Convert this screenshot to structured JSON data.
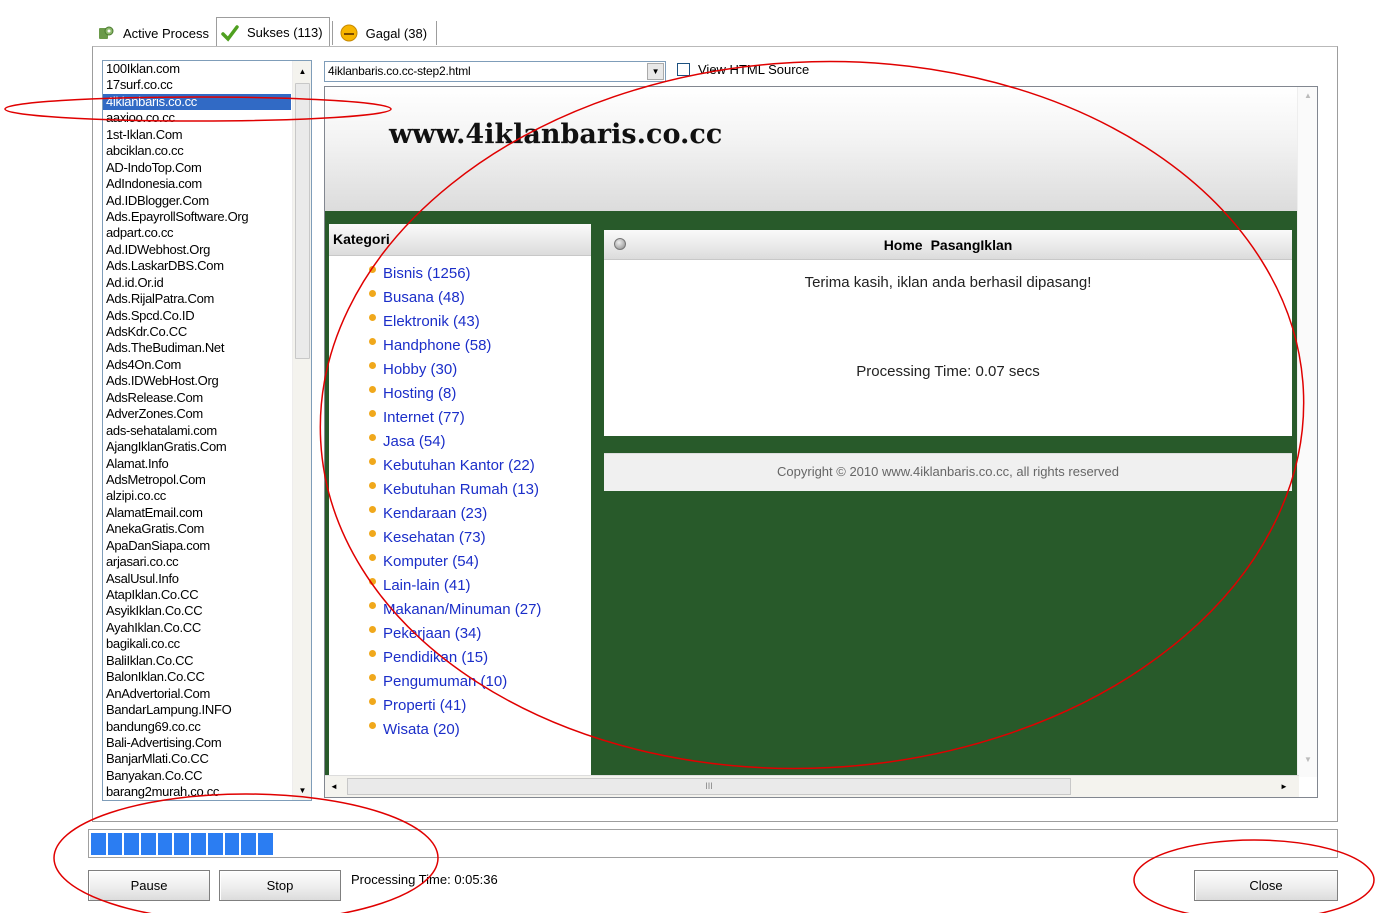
{
  "tabs": [
    {
      "label": "Active Process",
      "icon": "gear-process-icon",
      "active": false
    },
    {
      "label": "Sukses (113)",
      "icon": "checkmark-icon",
      "active": true
    },
    {
      "label": "Gagal (38)",
      "icon": "sad-face-icon",
      "active": false
    }
  ],
  "site_list": {
    "selected": "4iklanbaris.co.cc",
    "items": [
      "100Iklan.com",
      "17surf.co.cc",
      "4iklanbaris.co.cc",
      "aaxioo.co.cc",
      "1st-Iklan.Com",
      "abciklan.co.cc",
      "AD-IndoTop.Com",
      "AdIndonesia.com",
      "Ad.IDBlogger.Com",
      "Ads.EpayrollSoftware.Org",
      "adpart.co.cc",
      "Ad.IDWebhost.Org",
      "Ads.LaskarDBS.Com",
      "Ad.id.Or.id",
      "Ads.RijalPatra.Com",
      "Ads.Spcd.Co.ID",
      "AdsKdr.Co.CC",
      "Ads.TheBudiman.Net",
      "Ads4On.Com",
      "Ads.IDWebHost.Org",
      "AdsRelease.Com",
      "AdverZones.Com",
      "ads-sehatalami.com",
      "AjangIklanGratis.Com",
      "Alamat.Info",
      "AdsMetropol.Com",
      "alzipi.co.cc",
      "AlamatEmail.com",
      "AnekaGratis.Com",
      "ApaDanSiapa.com",
      "arjasari.co.cc",
      "AsalUsul.Info",
      "AtapIklan.Co.CC",
      "AsyikIklan.Co.CC",
      "AyahIklan.Co.CC",
      "bagikali.co.cc",
      "BaliIklan.Co.CC",
      "BalonIklan.Co.CC",
      "AnAdvertorial.Com",
      "BandarLampung.INFO",
      "bandung69.co.cc",
      "Bali-Advertising.Com",
      "BanjarMlati.Co.CC",
      "Banyakan.Co.CC",
      "barang2murah.co.cc"
    ]
  },
  "page_select": {
    "value": "4iklanbaris.co.cc-step2.html"
  },
  "view_html_source": {
    "label": "View HTML Source",
    "checked": false
  },
  "preview": {
    "site_title": "www.4iklanbaris.co.cc",
    "kategori_title": "Kategori",
    "categories": [
      "Bisnis (1256)",
      "Busana (48)",
      "Elektronik (43)",
      "Handphone (58)",
      "Hobby (30)",
      "Hosting (8)",
      "Internet (77)",
      "Jasa (54)",
      "Kebutuhan Kantor (22)",
      "Kebutuhan Rumah (13)",
      "Kendaraan (23)",
      "Kesehatan (73)",
      "Komputer (54)",
      "Lain-lain (41)",
      "Makanan/Minuman (27)",
      "Pekerjaan (34)",
      "Pendidikan (15)",
      "Pengumuman (10)",
      "Properti (41)",
      "Wisata (20)"
    ],
    "nav": {
      "home": "Home",
      "pasang": "PasangIklan"
    },
    "success_message": "Terima kasih, iklan anda berhasil dipasang!",
    "processing_time": "Processing Time: 0.07 secs",
    "copyright": "Copyright © 2010 www.4iklanbaris.co.cc, all rights reserved",
    "hscroll_grip": "III"
  },
  "progress": {
    "blocks": 11
  },
  "buttons": {
    "pause": "Pause",
    "stop": "Stop",
    "close": "Close"
  },
  "status": {
    "processing_time": "Processing Time: 0:05:36"
  },
  "colors": {
    "selection": "#316ac5",
    "progress": "#2b7df2",
    "site_bg": "#285a2a",
    "link": "#1b2ec9",
    "annotation": "#e00000"
  }
}
